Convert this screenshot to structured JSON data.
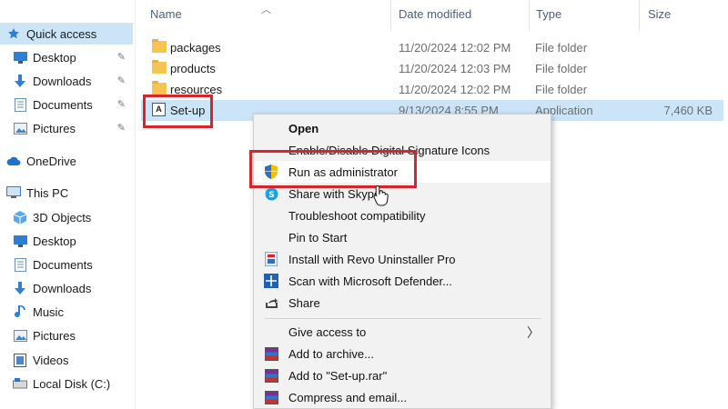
{
  "nav": {
    "items": [
      {
        "label": "Quick access",
        "icon": "star-icon",
        "pinned": false,
        "selected": true
      },
      {
        "label": "Desktop",
        "icon": "desktop-icon",
        "pinned": true
      },
      {
        "label": "Downloads",
        "icon": "download-icon",
        "pinned": true
      },
      {
        "label": "Documents",
        "icon": "document-icon",
        "pinned": true
      },
      {
        "label": "Pictures",
        "icon": "pictures-icon",
        "pinned": true
      },
      {
        "label": "OneDrive",
        "icon": "cloud-icon"
      },
      {
        "label": "This PC",
        "icon": "computer-icon"
      },
      {
        "label": "3D Objects",
        "icon": "cube-icon"
      },
      {
        "label": "Desktop",
        "icon": "desktop-icon"
      },
      {
        "label": "Documents",
        "icon": "document-icon"
      },
      {
        "label": "Downloads",
        "icon": "download-icon"
      },
      {
        "label": "Music",
        "icon": "music-icon"
      },
      {
        "label": "Pictures",
        "icon": "pictures-icon"
      },
      {
        "label": "Videos",
        "icon": "video-icon"
      },
      {
        "label": "Local Disk (C:)",
        "icon": "disk-icon"
      }
    ]
  },
  "columns": {
    "name": "Name",
    "date": "Date modified",
    "type": "Type",
    "size": "Size"
  },
  "files": [
    {
      "name": "packages",
      "date": "11/20/2024 12:02 PM",
      "type": "File folder",
      "size": ""
    },
    {
      "name": "products",
      "date": "11/20/2024 12:03 PM",
      "type": "File folder",
      "size": ""
    },
    {
      "name": "resources",
      "date": "11/20/2024 12:02 PM",
      "type": "File folder",
      "size": ""
    },
    {
      "name": "Set-up",
      "date": "9/13/2024 8:55 PM",
      "type": "Application",
      "size": "7,460 KB"
    }
  ],
  "menu": {
    "open": "Open",
    "signature": "Enable/Disable Digital Signature Icons",
    "run_admin": "Run as administrator",
    "skype": "Share with Skype",
    "troubleshoot": "Troubleshoot compatibility",
    "pin_start": "Pin to Start",
    "revo": "Install with Revo Uninstaller Pro",
    "defender": "Scan with Microsoft Defender...",
    "share": "Share",
    "give_access": "Give access to",
    "add_archive": "Add to archive...",
    "add_rar": "Add to \"Set-up.rar\"",
    "compress_email": "Compress and email..."
  },
  "app_icon_glyph": "A",
  "colors": {
    "selection": "#cce4f7",
    "highlight_box": "#d9242c",
    "folder": "#f6c451"
  }
}
